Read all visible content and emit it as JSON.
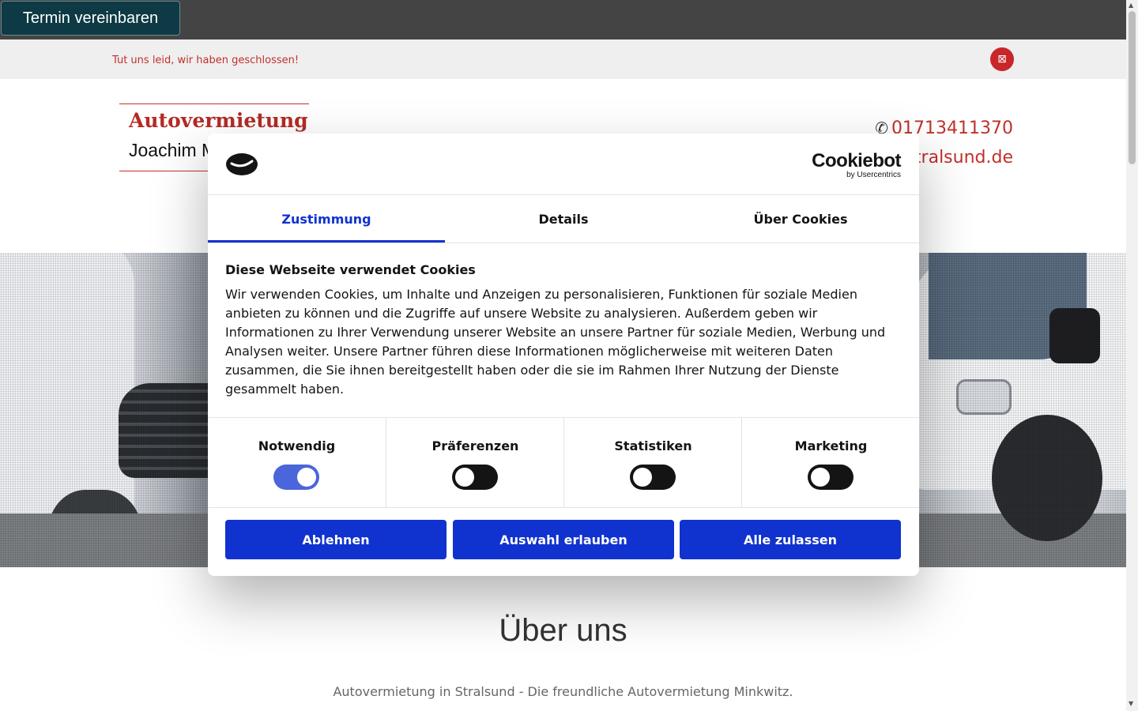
{
  "topbar": {
    "appointment_button": "Termin vereinbaren"
  },
  "notice": {
    "text": "Tut uns leid, wir haben geschlossen!",
    "close_icon": "⊠"
  },
  "header": {
    "logo_line1": "Autovermietung",
    "logo_line2": "Joachim M",
    "phone_icon": "✆",
    "phone": "01713411370",
    "website": "stralsund.de"
  },
  "section": {
    "title": "Über uns",
    "text": "Autovermietung in Stralsund - Die freundliche Autovermietung Minkwitz."
  },
  "cookie_dialog": {
    "brand_name": "Cookiebot",
    "brand_sub": "by Usercentrics",
    "tabs": [
      {
        "label": "Zustimmung",
        "active": true
      },
      {
        "label": "Details",
        "active": false
      },
      {
        "label": "Über Cookies",
        "active": false
      }
    ],
    "heading": "Diese Webseite verwendet Cookies",
    "body": "Wir verwenden Cookies, um Inhalte und Anzeigen zu personalisieren, Funktionen für soziale Medien anbieten zu können und die Zugriffe auf unsere Website zu analysieren. Außerdem geben wir Informationen zu Ihrer Verwendung unserer Website an unsere Partner für soziale Medien, Werbung und Analysen weiter. Unsere Partner führen diese Informationen möglicherweise mit weiteren Daten zusammen, die Sie ihnen bereitgestellt haben oder die sie im Rahmen Ihrer Nutzung der Dienste gesammelt haben.",
    "categories": [
      {
        "label": "Notwendig",
        "enabled": true
      },
      {
        "label": "Präferenzen",
        "enabled": false
      },
      {
        "label": "Statistiken",
        "enabled": false
      },
      {
        "label": "Marketing",
        "enabled": false
      }
    ],
    "buttons": {
      "decline": "Ablehnen",
      "allow_selection": "Auswahl erlauben",
      "allow_all": "Alle zulassen"
    }
  },
  "scrollbar": {
    "up_icon": "▲",
    "down_icon": "▼"
  },
  "colors": {
    "accent_blue": "#1032cf",
    "brand_red": "#c0312b",
    "topbar": "#444444",
    "appointment_button": "#0d3a44"
  }
}
